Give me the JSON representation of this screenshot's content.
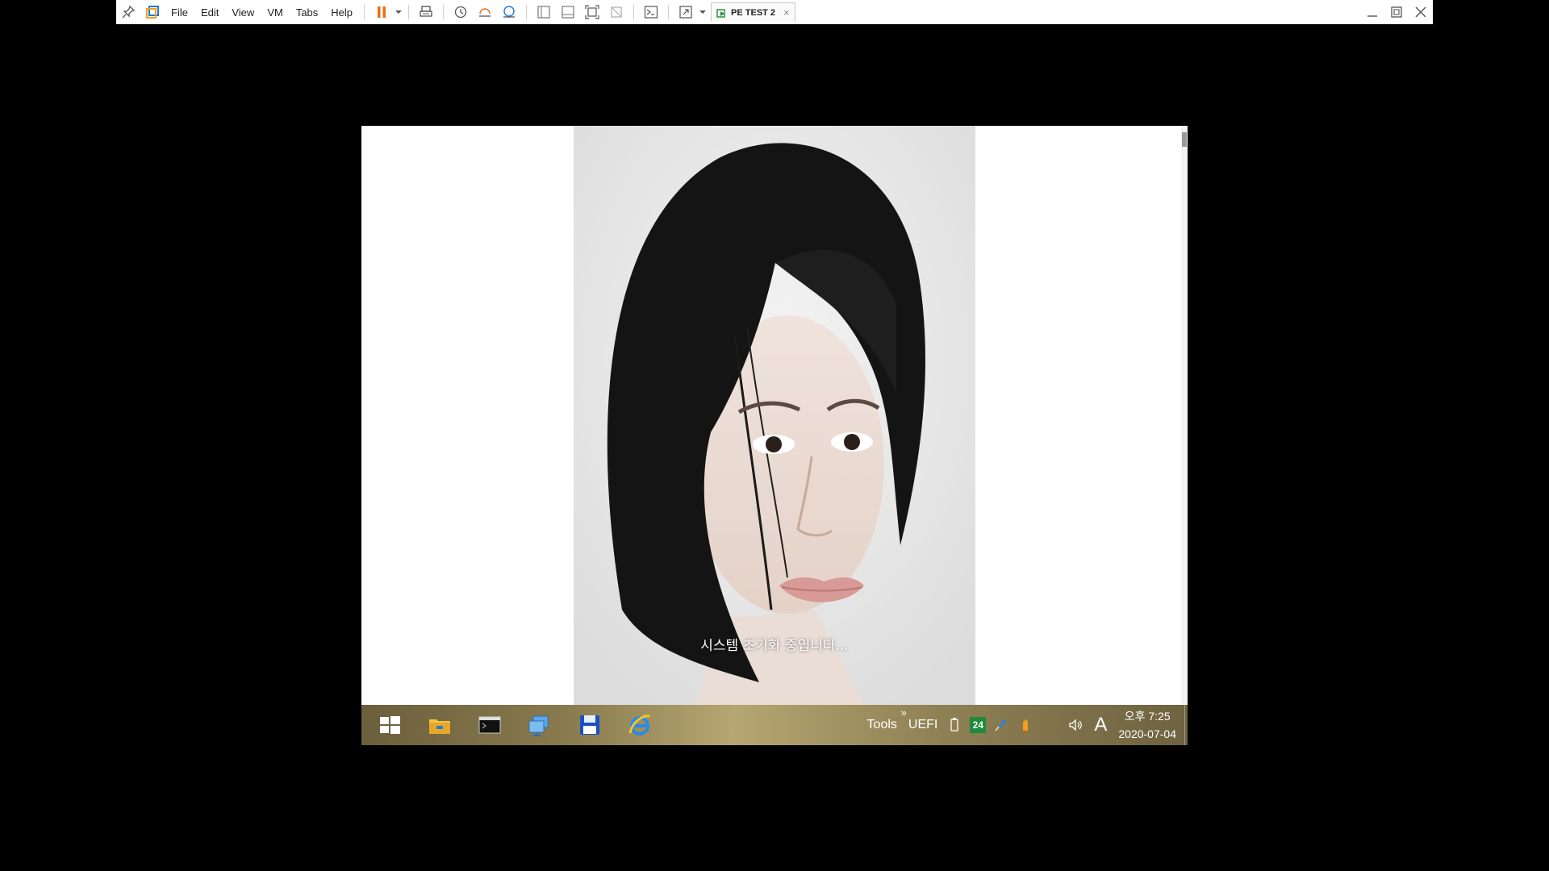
{
  "toolbar": {
    "menus": [
      "File",
      "Edit",
      "View",
      "VM",
      "Tabs",
      "Help"
    ],
    "tab_title": "PE TEST 2",
    "tab_close": "×"
  },
  "guest": {
    "status_message": "시스템 초기화 중입니다...",
    "taskbar": {
      "tools_label": "Tools",
      "tools_chevron": "»",
      "uefi_label": "UEFI",
      "badge_24": "24",
      "ime_indicator": "A",
      "clock_time": "오후 7:25",
      "clock_date": "2020-07-04"
    }
  },
  "colors": {
    "pause_orange": "#e8701a",
    "taskbar_gold": "#8a7b4e",
    "badge_green": "#1f8a3c"
  },
  "icons": [
    "pin-icon",
    "vmware-library-icon",
    "pause-icon",
    "dropdown-arrow-icon",
    "send-ctrl-alt-del-icon",
    "snapshot-icon",
    "revert-snapshot-icon",
    "snapshot-manager-icon",
    "single-pane-icon",
    "thumbnail-bar-icon",
    "full-screen-icon",
    "unity-icon",
    "console-view-icon",
    "stretch-guest-icon",
    "vm-tab-icon",
    "minimize-icon",
    "restore-icon",
    "close-icon",
    "windows-start-icon",
    "file-explorer-icon",
    "command-prompt-icon",
    "network-icon",
    "floppy-save-icon",
    "internet-explorer-icon",
    "usb-drive-icon",
    "pin-tool-icon",
    "pencil-tool-icon",
    "speaker-icon"
  ]
}
